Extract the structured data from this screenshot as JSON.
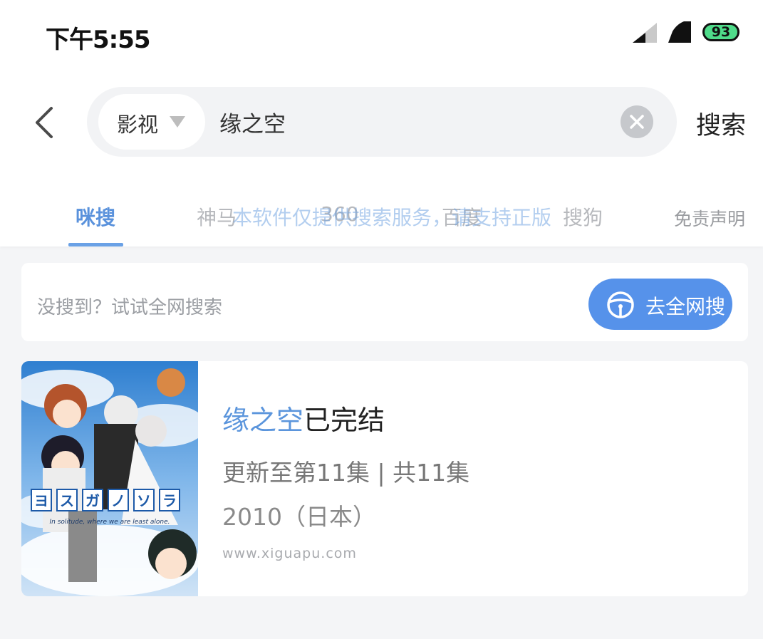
{
  "status_bar": {
    "time": "下午5:55",
    "battery": "93",
    "icons": [
      "signal-icon",
      "signal-icon",
      "battery-icon"
    ]
  },
  "search": {
    "category": "影视",
    "query": "缘之空",
    "submit_label": "搜索"
  },
  "tabs": [
    {
      "label": "咪搜",
      "active": true
    },
    {
      "label": "神马"
    },
    {
      "label": "360"
    },
    {
      "label": "百度"
    },
    {
      "label": "搜狗"
    }
  ],
  "watermark": "本软件仅提供搜索服务，请支持正版",
  "disclaimer": "免责声明",
  "web_search": {
    "hint": "没搜到？试试全网搜索",
    "button_label": "去全网搜"
  },
  "result": {
    "title_highlight": "缘之空",
    "title_rest": "已完结",
    "update": "更新至第11集 | 共11集",
    "year": "2010（日本）",
    "source": "www.xiguapu.com",
    "poster_text": [
      "ヨ",
      "ス",
      "ガ",
      "ノ",
      "ソ",
      "ラ"
    ],
    "poster_subtitle": "In solitude, where we are least alone."
  },
  "colors": {
    "accent": "#5692ea",
    "tab_active": "#5a92dc",
    "battery": "#4fdc8a"
  }
}
